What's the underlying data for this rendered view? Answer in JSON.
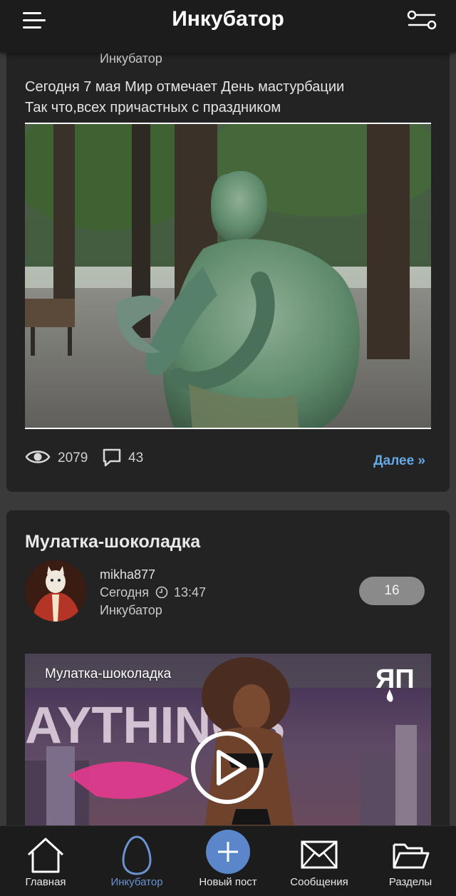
{
  "app": {
    "title": "Инкубатор"
  },
  "posts": [
    {
      "section": "Инкубатор",
      "text_lines": [
        "Сегодня 7 мая Мир отмечает День мастурбации",
        "Так что,всех причастных с праздником"
      ],
      "views": "2079",
      "comments": "43",
      "more_label": "Далее »"
    },
    {
      "title": "Мулатка-шоколадка",
      "author": "mikha877",
      "date": "Сегодня",
      "time": "13:47",
      "section": "Инкубатор",
      "rating": "16",
      "video_title": "Мулатка-шоколадка",
      "watermark": "ЯП",
      "video_bg_text": "AYTHINGS"
    }
  ],
  "nav": [
    {
      "label": "Главная",
      "icon": "home-icon"
    },
    {
      "label": "Инкубатор",
      "icon": "egg-icon",
      "active": true
    },
    {
      "label": "Новый пост",
      "icon": "plus-icon"
    },
    {
      "label": "Сообщения",
      "icon": "envelope-icon"
    },
    {
      "label": "Разделы",
      "icon": "folder-icon"
    }
  ],
  "colors": {
    "accent": "#64a8e4",
    "nav_active": "#6a93cf",
    "new_post_button": "#5b86c9",
    "background": "#3a3a3a",
    "card": "#232323",
    "bars": "#1c1c1c"
  }
}
